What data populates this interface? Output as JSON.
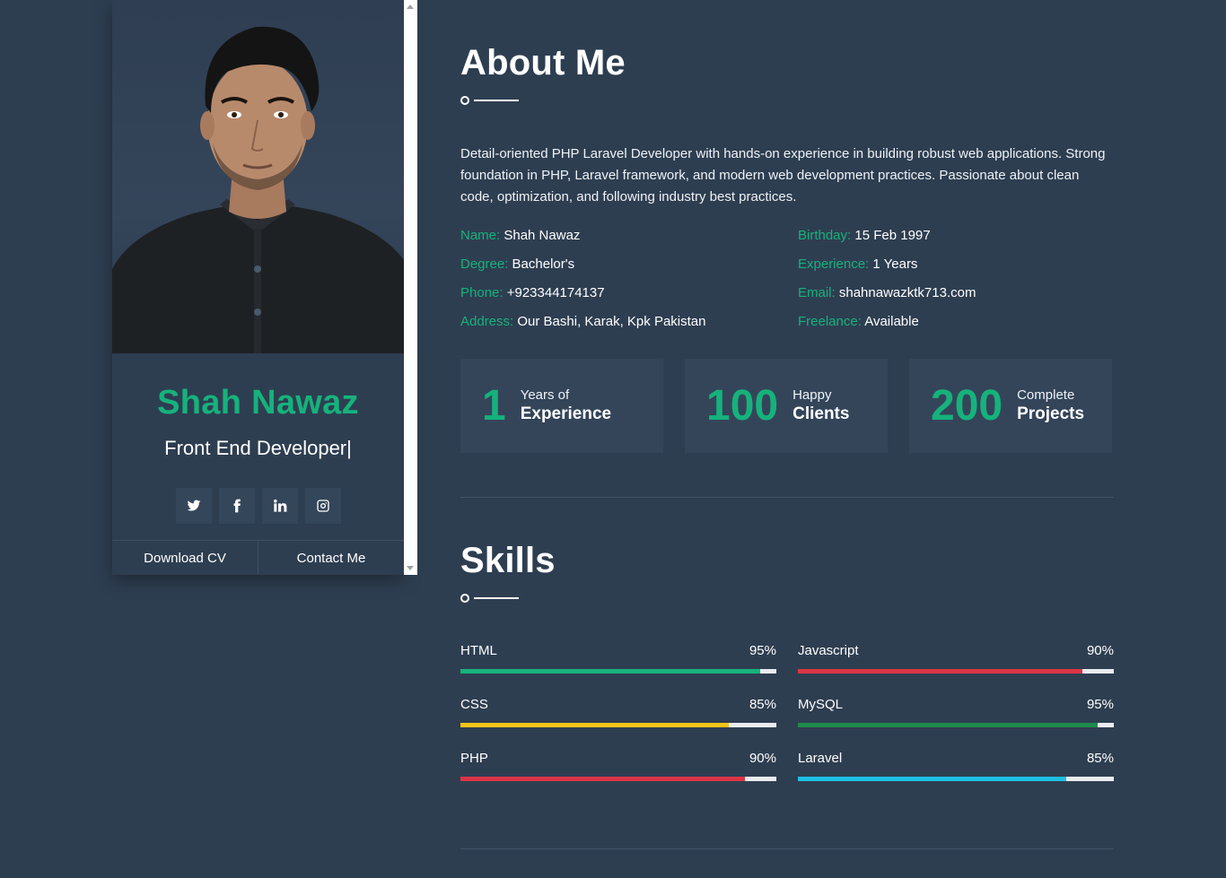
{
  "profile": {
    "name": "Shah Nawaz",
    "role": "Front End Developer",
    "cursor": "|",
    "photo_alt": "profile-photo",
    "social": [
      "twitter",
      "facebook",
      "linkedin",
      "instagram"
    ],
    "actions": {
      "download": "Download CV",
      "contact": "Contact Me"
    }
  },
  "about": {
    "title": "About Me",
    "text": "Detail-oriented PHP Laravel Developer with hands-on experience in building robust web applications. Strong foundation in PHP, Laravel framework, and modern web development practices. Passionate about clean code, optimization, and following industry best practices.",
    "info": [
      {
        "key": "Name:",
        "value": "Shah Nawaz"
      },
      {
        "key": "Birthday:",
        "value": "15 Feb 1997"
      },
      {
        "key": "Degree:",
        "value": "Bachelor's"
      },
      {
        "key": "Experience:",
        "value": "1 Years"
      },
      {
        "key": "Phone:",
        "value": "+923344174137"
      },
      {
        "key": "Email:",
        "value": "shahnawazktk713.com"
      },
      {
        "key": "Address:",
        "value": "Our Bashi, Karak, Kpk Pakistan"
      },
      {
        "key": "Freelance:",
        "value": "Available"
      }
    ],
    "stats": [
      {
        "number": "1",
        "small": "Years of",
        "big": "Experience"
      },
      {
        "number": "100",
        "small": "Happy",
        "big": "Clients"
      },
      {
        "number": "200",
        "small": "Complete",
        "big": "Projects"
      }
    ]
  },
  "skills": {
    "title": "Skills",
    "items": [
      {
        "name": "HTML",
        "percent": "95%",
        "value": 95,
        "color": "#16b27c"
      },
      {
        "name": "Javascript",
        "percent": "90%",
        "value": 90,
        "color": "#dc3545"
      },
      {
        "name": "CSS",
        "percent": "85%",
        "value": 85,
        "color": "#f5c518"
      },
      {
        "name": "MySQL",
        "percent": "95%",
        "value": 95,
        "color": "#1e8a4c"
      },
      {
        "name": "PHP",
        "percent": "90%",
        "value": 90,
        "color": "#dc3545"
      },
      {
        "name": "Laravel",
        "percent": "85%",
        "value": 85,
        "color": "#1ec0e6"
      }
    ]
  },
  "colors": {
    "background": "#2e3e51",
    "accent": "#16b27c"
  }
}
